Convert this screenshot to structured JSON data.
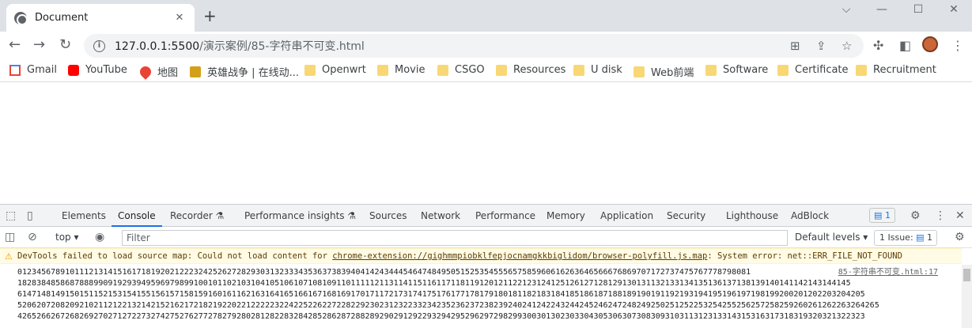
{
  "tab": {
    "title": "Document",
    "close": "✕",
    "new_tab": "+"
  },
  "window": {
    "minimize": "⌵",
    "restore": "—",
    "maximize": "☐",
    "close": "✕"
  },
  "toolbar": {
    "url_host": "127.0.0.1:5500",
    "url_path": "/演示案例/85-字符串不可变.html"
  },
  "bookmarks": [
    {
      "label": "Gmail",
      "icon": "gmail-icon"
    },
    {
      "label": "YouTube",
      "icon": "youtube-icon"
    },
    {
      "label": "地图",
      "icon": "maps-icon"
    },
    {
      "label": "英雄战争 | 在线动...",
      "icon": "game-icon"
    },
    {
      "label": "Openwrt",
      "icon": "folder-icon"
    },
    {
      "label": "Movie",
      "icon": "folder-icon"
    },
    {
      "label": "CSGO",
      "icon": "folder-icon"
    },
    {
      "label": "Resources",
      "icon": "folder-icon"
    },
    {
      "label": "U disk",
      "icon": "folder-icon"
    },
    {
      "label": "Web前端",
      "icon": "folder-icon"
    },
    {
      "label": "Software",
      "icon": "folder-icon"
    },
    {
      "label": "Certificate",
      "icon": "folder-icon"
    },
    {
      "label": "Recruitment",
      "icon": "folder-icon"
    }
  ],
  "devtools": {
    "tabs": [
      "Elements",
      "Console",
      "Recorder ⚗",
      "Performance insights ⚗",
      "Sources",
      "Network",
      "Performance",
      "Memory",
      "Application",
      "Security",
      "Lighthouse",
      "AdBlock"
    ],
    "active_tab": "Console",
    "badge": "1",
    "context": "top ▾",
    "filter_placeholder": "Filter",
    "levels": "Default levels ▾",
    "issues": "1 Issue: ",
    "issues_count": "1",
    "warning": {
      "text": "DevTools failed to load source map: Could not load content for ",
      "link": "chrome-extension://gighmmpiobklfepjocnamgkkbiglidom/browser-polyfill.js.map",
      "rest": ": System error: net::ERR_FILE_NOT_FOUND"
    },
    "log_source": "85-字符串不可变.html:17",
    "log_lines": [
      "0123456789101112131415161718192021222324252627282930313233343536373839404142434445464748495051525354555657585960616263646566676869707172737475767778798081",
      "1828384858687888990919293949596979899100101102103104105106107108109110111112113114115116117118119120121122123124125126127128129130131132133134135136137138139140141142143144145",
      "6147148149150151152153154155156157158159160161162163164165166167168169170171172173174175176177178179180181182183184185186187188189190191192193194195196197198199200201202203204205",
      "5206207208209210211212213214215216217218219220221222223224225226227228229230231232233234235236237238239240241242243244245246247248249250251252253254255256257258259260261262263264265",
      "4265266267268269270271272273274275276277278279280281282283284285286287288289290291292293294295296297298299300301302303304305306307308309310311312313314315316317318319320321322323"
    ]
  }
}
